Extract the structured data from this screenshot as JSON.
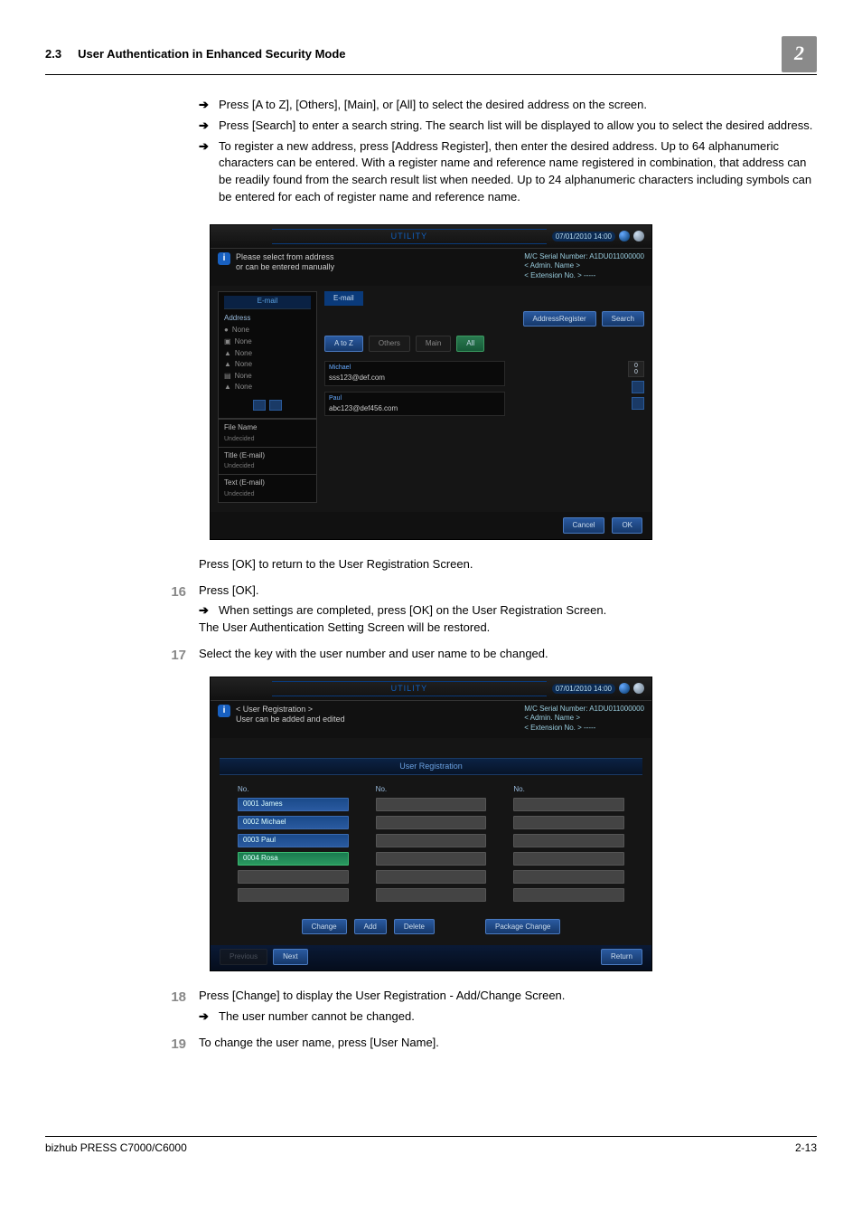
{
  "header": {
    "section_num": "2.3",
    "section_title": "User Authentication in Enhanced Security Mode",
    "chapter": "2"
  },
  "bullets": [
    "Press [A to Z], [Others], [Main], or [All] to select the desired address on the screen.",
    "Press [Search] to enter a search string. The search list will be displayed to allow you to select the desired address.",
    "To register a new address, press [Address Register], then enter the desired address. Up to 64 alphanumeric characters can be entered. With a register name and reference name registered in combination, that address can be readily found from the search result list when needed. Up to 24 alphanumeric characters including symbols can be entered for each of register name and reference name."
  ],
  "shot1": {
    "util": "UTILITY",
    "date": "07/01/2010 14:00",
    "info": "Please select from address\nor can be entered manually",
    "serial": {
      "a": "M/C Serial Number: A1DU011000000",
      "b": "< Admin. Name >",
      "c": "< Extension No. > -----"
    },
    "left": {
      "tab": "E-mail",
      "address": "Address",
      "none": "None",
      "file": "File Name",
      "file_sub": "Undecided",
      "title": "Title (E-mail)",
      "title_sub": "Undecided",
      "text": "Text (E-mail)",
      "text_sub": "Undecided"
    },
    "etab": "E-mail",
    "addr_reg": "AddressRegister",
    "search": "Search",
    "atoz": "A to Z",
    "others": "Others",
    "main": "Main",
    "all": "All",
    "email1_h": "Michael",
    "email1_v": "sss123@def.com",
    "email2_h": "Paul",
    "email2_v": "abc123@def456.com",
    "count": "0\n0",
    "cancel": "Cancel",
    "ok": "OK"
  },
  "caption1": "Press [OK] to return to the User Registration Screen.",
  "step16": {
    "num": "16",
    "line": "Press [OK].",
    "sub": "When settings are completed, press [OK] on the User Registration Screen.",
    "line2": "The User Authentication Setting Screen will be restored."
  },
  "step17": {
    "num": "17",
    "line": "Select the key with the user number and user name to be changed."
  },
  "shot2": {
    "util": "UTILITY",
    "date": "07/01/2010 14:00",
    "info": "< User Registration >\nUser can be added and edited",
    "serial": {
      "a": "M/C Serial Number: A1DU011000000",
      "b": "< Admin. Name >",
      "c": "< Extension No. > -----"
    },
    "title": "User Registration",
    "colhdr": "No.",
    "users": [
      "0001 James",
      "0002 Michael",
      "0003 Paul",
      "0004 Rosa"
    ],
    "change": "Change",
    "add": "Add",
    "delete": "Delete",
    "pkg": "Package Change",
    "prev": "Previous",
    "next": "Next",
    "return": "Return"
  },
  "step18": {
    "num": "18",
    "line": "Press [Change] to display the User Registration - Add/Change Screen.",
    "sub": "The user number cannot be changed."
  },
  "step19": {
    "num": "19",
    "line": "To change the user name, press [User Name]."
  },
  "footer": {
    "left": "bizhub PRESS C7000/C6000",
    "right": "2-13"
  }
}
